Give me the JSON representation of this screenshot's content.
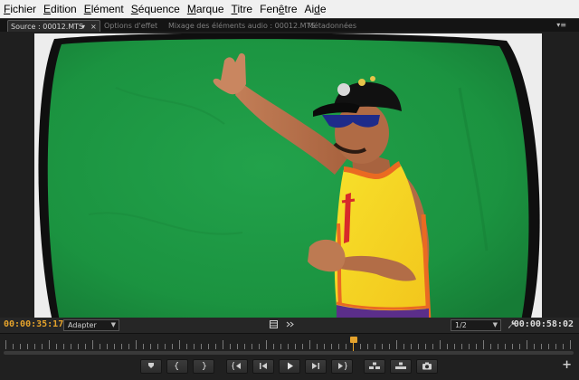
{
  "menu": {
    "items": [
      {
        "label": "Fichier",
        "mnemonic": "F",
        "rest": "ichier"
      },
      {
        "label": "Edition",
        "mnemonic": "E",
        "rest": "dition"
      },
      {
        "label": "Elément",
        "mnemonic": "E",
        "rest": "lément"
      },
      {
        "label": "Séquence",
        "mnemonic": "S",
        "rest": "équence"
      },
      {
        "label": "Marque",
        "mnemonic": "M",
        "rest": "arque"
      },
      {
        "label": "Titre",
        "mnemonic": "T",
        "rest": "itre"
      },
      {
        "label": "Fenêtre",
        "pre": "Fen",
        "mnemonic": "ê",
        "rest": "tre"
      },
      {
        "label": "Aide",
        "pre": "Ai",
        "mnemonic": "d",
        "rest": "e"
      }
    ]
  },
  "tabs": {
    "source": "Source : 00012.MTS",
    "source_dropdown": "▾",
    "source_close": "×",
    "effects": "Options d'effet",
    "audio_mixer": "Mixage des éléments audio : 00012.MTS",
    "metadata": "Métadonnées",
    "panel_menu": "▾≡"
  },
  "controls": {
    "timecode_current": "00:00:35:17",
    "fit_select": "Adapter",
    "resolution_select": "1/2",
    "timecode_duration": "00:00:58:02"
  },
  "icons": {
    "film": "film-icon",
    "export": "export-frame-icon",
    "wrench": "wrench-icon",
    "playhead": "playhead-icon"
  },
  "colors": {
    "timecode_current": "#e5a32c",
    "playhead": "#e5a32c",
    "green_screen": "#1f9a45"
  },
  "transport": {
    "add_marker": "add-marker-icon",
    "mark_in": "mark-in-icon",
    "mark_out": "mark-out-icon",
    "go_to_in": "go-to-in-icon",
    "step_back": "step-back-icon",
    "play": "play-icon",
    "step_forward": "step-forward-icon",
    "go_to_out": "go-to-out-icon",
    "insert": "insert-icon",
    "overwrite": "overwrite-icon",
    "export_frame": "camera-icon",
    "add_button": "+"
  }
}
